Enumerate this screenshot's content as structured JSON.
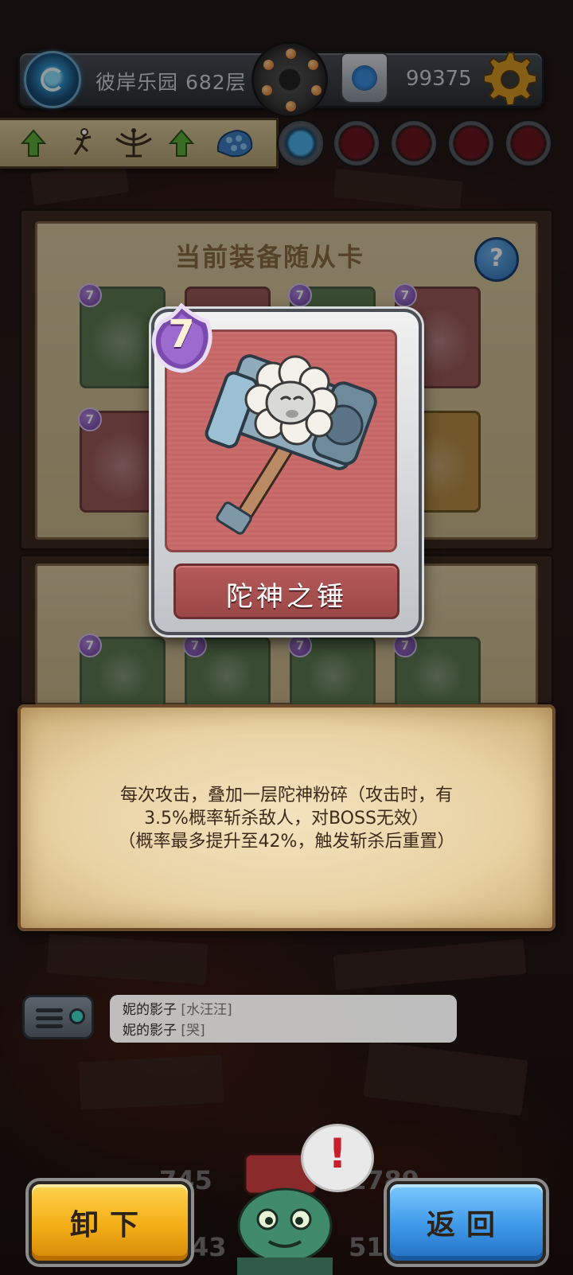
{
  "top_bar": {
    "location": "彼岸乐园 682层",
    "currency": "99375",
    "location_icon": "portal-icon",
    "currency_icon": "yeti-token-icon",
    "settings_icon": "gear-icon"
  },
  "buffs": [
    "arrow-up-icon",
    "dancer-icon",
    "trophy-icon",
    "arrow-up-icon",
    "scales-icon"
  ],
  "panel": {
    "title": "当前装备随从卡",
    "help": "?"
  },
  "mini_cards": {
    "level": "7"
  },
  "selected_card": {
    "level": "7",
    "name": "陀神之锤"
  },
  "description": {
    "line1": "每次攻击，叠加一层陀神粉碎（攻击时，有",
    "line2": "3.5%概率斩杀敌人，对BOSS无效）",
    "line3": "（概率最多提升至42%，触发斩杀后重置）"
  },
  "chat": {
    "messages": [
      {
        "user": "妮的影子",
        "emote": "[水汪汪]"
      },
      {
        "user": "妮的影子",
        "emote": "[哭]"
      }
    ]
  },
  "bottom_stats": {
    "left_top": "745",
    "left_bottom": "43",
    "right_top": "1789",
    "right_bottom": "51"
  },
  "alert": "!",
  "buttons": {
    "unequip": "卸下",
    "back": "返回"
  },
  "colors": {
    "unequip_button": "#f3ae17",
    "back_button": "#3e98e8",
    "card_red": "#c96c6c",
    "level_badge": "#6e3fa3"
  }
}
